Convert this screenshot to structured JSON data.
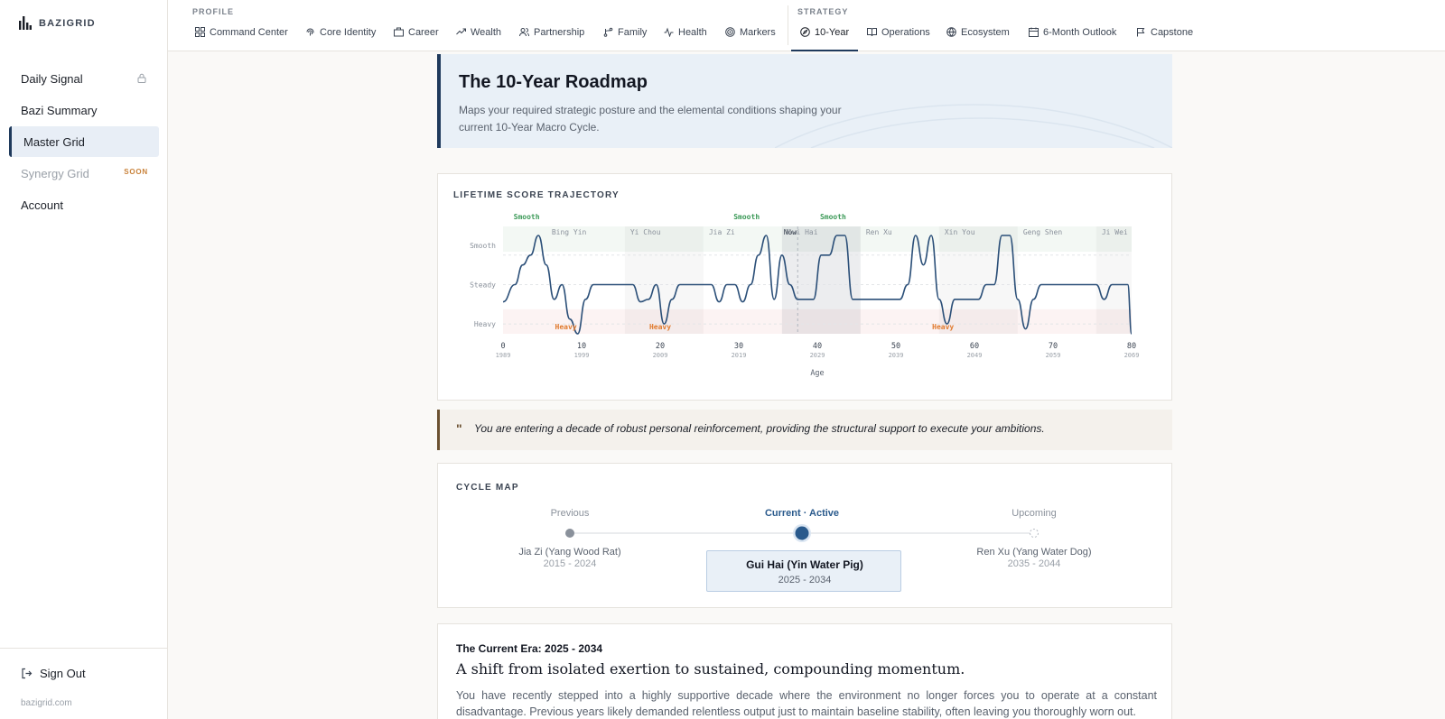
{
  "brand": {
    "name": "BAZIGRID"
  },
  "sidebar": {
    "items": [
      {
        "label": "Daily Signal",
        "locked": true
      },
      {
        "label": "Bazi Summary"
      },
      {
        "label": "Master Grid",
        "active": true
      },
      {
        "label": "Synergy Grid",
        "badge": "SOON",
        "disabled": true
      },
      {
        "label": "Account"
      }
    ],
    "signout": "Sign Out",
    "domain": "bazigrid.com"
  },
  "topnav": {
    "profile_label": "PROFILE",
    "strategy_label": "STRATEGY",
    "profile_tabs": [
      {
        "label": "Command Center",
        "icon": "grid-icon"
      },
      {
        "label": "Core Identity",
        "icon": "fingerprint-icon"
      },
      {
        "label": "Career",
        "icon": "briefcase-icon"
      },
      {
        "label": "Wealth",
        "icon": "trend-up-icon"
      },
      {
        "label": "Partnership",
        "icon": "users-icon"
      },
      {
        "label": "Family",
        "icon": "branch-icon"
      },
      {
        "label": "Health",
        "icon": "pulse-icon"
      },
      {
        "label": "Markers",
        "icon": "target-icon"
      }
    ],
    "strategy_tabs": [
      {
        "label": "10-Year",
        "icon": "compass-icon",
        "active": true
      },
      {
        "label": "Operations",
        "icon": "book-icon"
      },
      {
        "label": "Ecosystem",
        "icon": "globe-icon"
      },
      {
        "label": "6-Month Outlook",
        "icon": "calendar-icon"
      },
      {
        "label": "Capstone",
        "icon": "flag-icon"
      }
    ]
  },
  "hero": {
    "title": "The 10-Year Roadmap",
    "subtitle": "Maps your required strategic posture and the elemental conditions shaping your current 10-Year Macro Cycle."
  },
  "trajectory": {
    "title": "LIFETIME SCORE TRAJECTORY"
  },
  "chart_data": {
    "type": "line",
    "title": "LIFETIME SCORE TRAJECTORY",
    "xlabel": "Age",
    "ylabel": "",
    "xlim": [
      0,
      80
    ],
    "ylim": [
      0,
      2
    ],
    "y_levels": [
      "Heavy",
      "Steady",
      "Smooth"
    ],
    "x_ticks": [
      0,
      10,
      20,
      30,
      40,
      50,
      60,
      70,
      80
    ],
    "x_years": [
      "1989",
      "1999",
      "2009",
      "2019",
      "2029",
      "2039",
      "2049",
      "2059",
      "2069"
    ],
    "now_age": 37.5,
    "now_label": "Now",
    "decades": [
      {
        "label": "Bing Yin",
        "start": 5.5
      },
      {
        "label": "Yi Chou",
        "start": 15.5
      },
      {
        "label": "Jia Zi",
        "start": 25.5
      },
      {
        "label": "Gui Hai",
        "start": 35.5
      },
      {
        "label": "Ren Xu",
        "start": 45.5
      },
      {
        "label": "Xin You",
        "start": 55.5
      },
      {
        "label": "Geng Shen",
        "start": 65.5
      },
      {
        "label": "Ji Wei",
        "start": 75.5
      }
    ],
    "annotations": [
      {
        "text": "Smooth",
        "x": 3,
        "kind": "smooth"
      },
      {
        "text": "Heavy",
        "x": 8,
        "kind": "heavy"
      },
      {
        "text": "Heavy",
        "x": 20,
        "kind": "heavy"
      },
      {
        "text": "Smooth",
        "x": 31,
        "kind": "smooth"
      },
      {
        "text": "Smooth",
        "x": 42,
        "kind": "smooth"
      },
      {
        "text": "Heavy",
        "x": 56,
        "kind": "heavy"
      }
    ],
    "series": [
      {
        "x": [
          0,
          1.5,
          2.5,
          3.5,
          4.5,
          5.5,
          6.5,
          7.5,
          8.5,
          9.5,
          10.5,
          11.5,
          12.5,
          13.5,
          14.5,
          15.5,
          16.5,
          17.5,
          18.5,
          19.5,
          20.5,
          21.5,
          22.5,
          23.5,
          24.5,
          25.5,
          26.5,
          27.5,
          28.5,
          29.5,
          30.5,
          31.5,
          32.5,
          33.5,
          34.5,
          35.5,
          36.5,
          37.5,
          38.5,
          39.5,
          40.5,
          41.5,
          42.5,
          43.5,
          44.5,
          45.5,
          46.5,
          47.5,
          48.5,
          49.5,
          50.5,
          51.5,
          52.5,
          53.5,
          54.5,
          55.5,
          56.5,
          57.5,
          58.5,
          59.5,
          60.5,
          61.5,
          62.5,
          63.5,
          64.5,
          65.5,
          66.5,
          67.5,
          68.5,
          69.5,
          70.5,
          71.5,
          72.5,
          73.5,
          74.5,
          75.5,
          76.5,
          77.5,
          78.5,
          79.5,
          80
        ],
        "y": [
          0.65,
          1,
          1.4,
          1.6,
          2,
          1.4,
          0.7,
          1,
          0.3,
          0,
          0.7,
          1,
          1,
          1,
          1,
          1,
          1,
          0.65,
          0.7,
          1,
          0.2,
          0.7,
          1,
          1,
          1,
          1,
          1,
          0.65,
          1,
          1,
          0.65,
          1,
          1.6,
          2,
          0.7,
          1.6,
          1,
          0.7,
          0.7,
          0.7,
          1.6,
          1.6,
          2,
          2,
          0.7,
          0.7,
          0.7,
          0.7,
          0.7,
          0.7,
          0.7,
          1,
          2,
          1.4,
          2,
          0.7,
          0.2,
          0.7,
          0.7,
          0.7,
          0.7,
          1,
          1,
          2,
          2,
          0.7,
          0.1,
          0.7,
          1,
          1,
          1,
          1,
          1,
          1,
          1,
          1,
          0.7,
          1,
          1,
          1,
          0
        ]
      }
    ]
  },
  "quote": {
    "text": "You are entering a decade of robust personal reinforcement, providing the structural support to execute your ambitions."
  },
  "cycle_map": {
    "title": "CYCLE MAP",
    "previous": {
      "label": "Previous",
      "name": "Jia Zi (Yang Wood Rat)",
      "years": "2015 - 2024"
    },
    "current": {
      "label": "Current · Active",
      "name": "Gui Hai (Yin Water Pig)",
      "years": "2025 - 2034"
    },
    "upcoming": {
      "label": "Upcoming",
      "name": "Ren Xu (Yang Water Dog)",
      "years": "2035 - 2044"
    }
  },
  "era": {
    "title": "The Current Era: 2025 - 2034",
    "headline": "A shift from isolated exertion to sustained, compounding momentum.",
    "body": "You have recently stepped into a highly supportive decade where the environment no longer forces you to operate at a constant disadvantage. Previous years likely demanded relentless output just to maintain baseline stability, often leaving you thoroughly worn out."
  },
  "colors": {
    "accent": "#1f3a5c",
    "line": "#2b4f78",
    "smooth": "#3c9a58",
    "heavy": "#e07a2e",
    "quote_border": "#6b5131"
  }
}
